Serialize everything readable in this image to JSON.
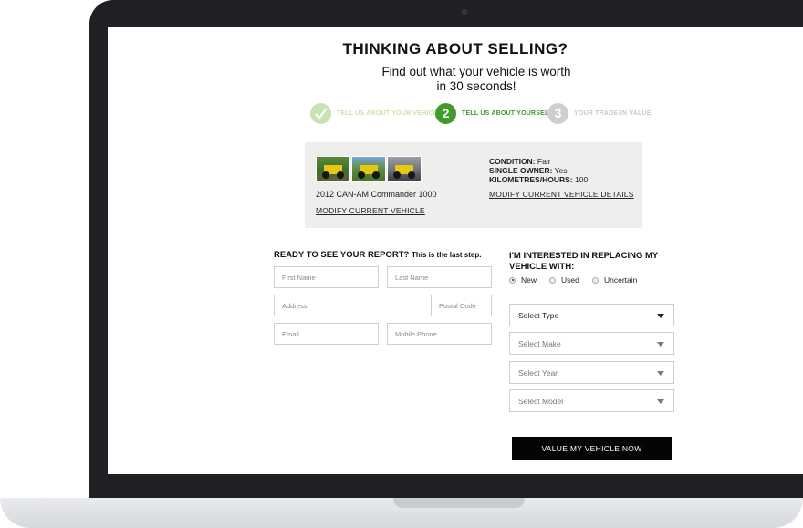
{
  "header": {
    "title": "THINKING ABOUT SELLING?",
    "subtitle_line1": "Find out what your vehicle is worth",
    "subtitle_line2": "in 30 seconds!"
  },
  "steps": [
    {
      "number": "1",
      "label": "TELL US ABOUT YOUR VEHICLE",
      "state": "complete",
      "icon": "check-icon"
    },
    {
      "number": "2",
      "label": "TELL US ABOUT YOURSELF",
      "state": "current"
    },
    {
      "number": "3",
      "label": "YOUR TRADE-IN VALUE",
      "state": "upcoming"
    }
  ],
  "vehicle": {
    "name": "2012 CAN-AM Commander 1000",
    "modify_vehicle": "MODIFY CURRENT VEHICLE",
    "condition_label": "CONDITION:",
    "condition_value": "Fair",
    "owner_label": "SINGLE OWNER:",
    "owner_value": "Yes",
    "km_label": "KILOMETRES/HOURS:",
    "km_value": "100",
    "modify_details": "MODIFY CURRENT VEHICLE DETAILS"
  },
  "form": {
    "heading": "READY TO SEE YOUR REPORT?",
    "heading_note": "This is the last step.",
    "first_name": "First Name",
    "last_name": "Last Name",
    "address": "Address",
    "postal_code": "Postal Code",
    "email": "Email",
    "mobile_phone": "Mobile Phone"
  },
  "interest": {
    "heading": "I'M INTERESTED IN REPLACING MY VEHICLE WITH:",
    "options": [
      "New",
      "Used",
      "Uncertain"
    ],
    "selected": "New",
    "select_type": "Select Type",
    "select_make": "Select Make",
    "select_year": "Select Year",
    "select_model": "Select Model",
    "submit": "VALUE MY VEHICLE NOW"
  },
  "colors": {
    "accent_green": "#3f9c2b",
    "light_green": "#c7e3b3",
    "inactive_gray": "#cfcfcf",
    "button_black": "#050505"
  }
}
